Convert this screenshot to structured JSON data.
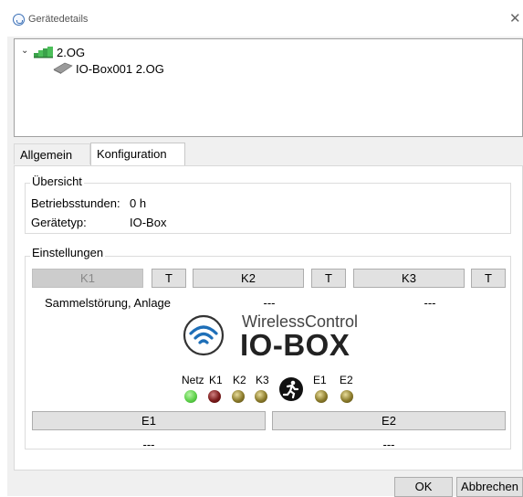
{
  "window": {
    "title": "Gerätedetails",
    "close_label": "✕"
  },
  "tree": {
    "root": {
      "label": "2.OG",
      "expander": "⌄",
      "icon": "network-group-icon"
    },
    "child": {
      "label": "IO-Box001 2.OG",
      "icon": "io-box-device-icon"
    }
  },
  "tabs": [
    {
      "label": "Allgemein",
      "active": false
    },
    {
      "label": "Konfiguration",
      "active": true
    }
  ],
  "overview": {
    "legend": "Übersicht",
    "operating_hours_label": "Betriebsstunden:",
    "operating_hours_value": "0 h",
    "device_type_label": "Gerätetyp:",
    "device_type_value": "IO-Box"
  },
  "settings": {
    "legend": "Einstellungen",
    "relays": [
      {
        "label": "K1",
        "test_label": "T",
        "status": "Sammelstörung, Anlage",
        "disabled": true
      },
      {
        "label": "K2",
        "test_label": "T",
        "status": "---",
        "disabled": false
      },
      {
        "label": "K3",
        "test_label": "T",
        "status": "---",
        "disabled": false
      }
    ],
    "logo": {
      "brand_line1": "WirelessControl",
      "brand_line2": "IO-BOX",
      "icon": "wireless-signal-icon"
    },
    "leds": [
      {
        "label": "Netz",
        "color": "#5ed04a"
      },
      {
        "label": "K1",
        "color": "#7a1a1a"
      },
      {
        "label": "K2",
        "color": "#8a7a2a"
      },
      {
        "label": "K3",
        "color": "#8a7a2a"
      },
      {
        "label": "",
        "icon": "emergency-exit-icon"
      },
      {
        "label": "E1",
        "color": "#8a7a2a"
      },
      {
        "label": "E2",
        "color": "#8a7a2a"
      }
    ],
    "inputs": [
      {
        "label": "E1",
        "status": "---"
      },
      {
        "label": "E2",
        "status": "---"
      }
    ]
  },
  "footer": {
    "ok_label": "OK",
    "cancel_label": "Abbrechen"
  }
}
